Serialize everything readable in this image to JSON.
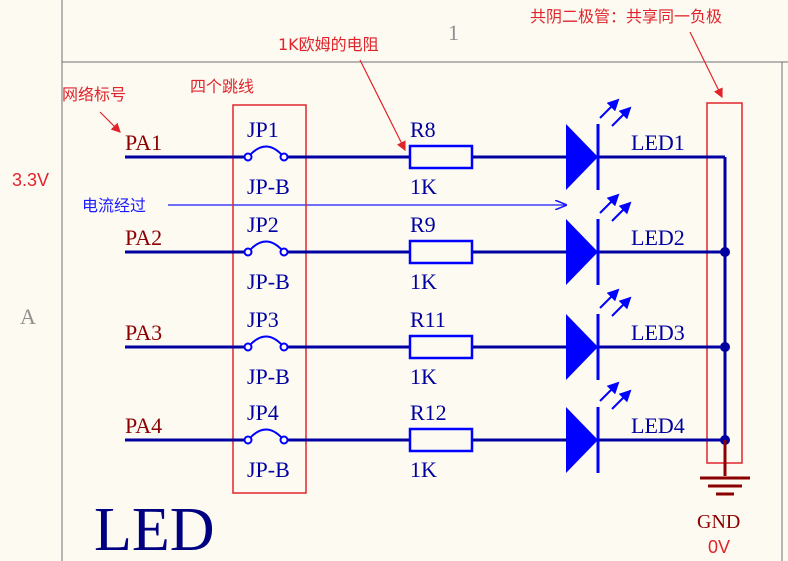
{
  "sheet": {
    "column_label": "1",
    "row_label": "A",
    "title": "LED"
  },
  "annotations": {
    "net_label": "网络标号",
    "jumpers": "四个跳线",
    "resistor": "1K欧姆的电阻",
    "common_cathode": "共阴二极管：共享同一负极",
    "current_flow": "电流经过",
    "voltage": "3.3V",
    "ground_voltage": "0V"
  },
  "channels": [
    {
      "net": "PA1",
      "jumper": "JP1",
      "jumper_type": "JP-B",
      "resistor": "R8",
      "resistance": "1K",
      "led": "LED1"
    },
    {
      "net": "PA2",
      "jumper": "JP2",
      "jumper_type": "JP-B",
      "resistor": "R9",
      "resistance": "1K",
      "led": "LED2"
    },
    {
      "net": "PA3",
      "jumper": "JP3",
      "jumper_type": "JP-B",
      "resistor": "R11",
      "resistance": "1K",
      "led": "LED3"
    },
    {
      "net": "PA4",
      "jumper": "JP4",
      "jumper_type": "JP-B",
      "resistor": "R12",
      "resistance": "1K",
      "led": "LED4"
    }
  ],
  "ground": {
    "label": "GND"
  },
  "colors": {
    "wire": "#0000a0",
    "component": "#0000ff",
    "net_text": "#8b0000",
    "annotation": "#e0242c",
    "title": "#000080",
    "border": "#707070",
    "background": "#fdfaf2"
  }
}
